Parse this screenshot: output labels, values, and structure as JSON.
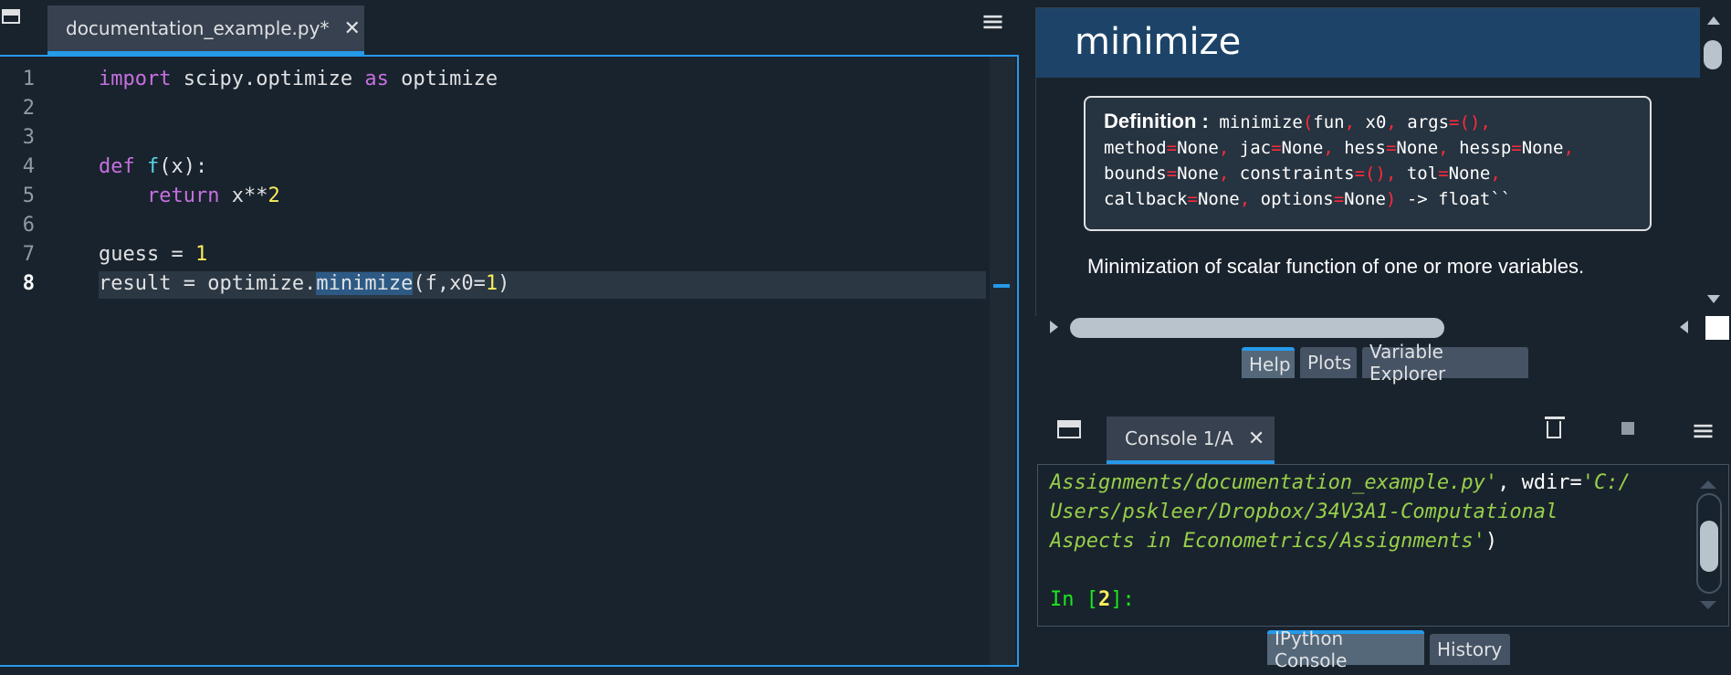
{
  "editor": {
    "tab_label": "documentation_example.py*",
    "tab_close": "✕",
    "menu_icon": "≡",
    "line_numbers": [
      "1",
      "2",
      "3",
      "4",
      "5",
      "6",
      "7",
      "8"
    ],
    "lines": {
      "l1_kw": "import",
      "l1_mod": " scipy.optimize ",
      "l1_as": "as",
      "l1_alias": " optimize",
      "l4_def": "def",
      "l4_name": "f",
      "l4_rest": "(x):",
      "l5_ret": "    return",
      "l5_rest": " x**",
      "l5_num": "2",
      "l7_lhs": "guess = ",
      "l7_num": "1",
      "l8_lhs": "result = optimize.",
      "l8_sel": "minimize",
      "l8_args": "(f,x0=",
      "l8_num": "1",
      "l8_close": ")"
    }
  },
  "help": {
    "title": "minimize",
    "definition_label": "Definition :",
    "definition_sig": {
      "name": " minimize",
      "open": "(",
      "p1": "fun",
      "p2": " x0",
      "p3": " args",
      "p3v": "()",
      "p4": "method",
      "p4v": "None",
      "p5": " jac",
      "p5v": "None",
      "p6": " hess",
      "p6v": "None",
      "p7": " hessp",
      "p7v": "None",
      "p8": "bounds",
      "p8v": "None",
      "p9": " constraints",
      "p9v": "()",
      "p10": " tol",
      "p10v": "None",
      "p11": "callback",
      "p11v": "None",
      "p12": " options",
      "p12v": "None",
      "close": ")",
      "ret": " -> float``"
    },
    "description": "Minimization of scalar function of one or more variables.",
    "tabs": [
      "Help",
      "Plots",
      "Variable Explorer"
    ]
  },
  "console": {
    "tab_label": "Console 1/A",
    "tab_close": "✕",
    "lines": {
      "c1a": "Assignments/documentation_example.py'",
      "c1b": ", wdir=",
      "c1c": "'C:/",
      "c2": "Users/pskleer/Dropbox/34V3A1-Computational",
      "c3a": "Aspects in Econometrics/Assignments'",
      "c3b": ")",
      "prompt_in": "In [",
      "prompt_num": "2",
      "prompt_end": "]:"
    },
    "tabs": [
      "IPython Console",
      "History"
    ]
  },
  "colors": {
    "accent": "#259ae9",
    "background": "#19232d",
    "keyword": "#c670e0",
    "function": "#57d6e4",
    "number": "#faed5c",
    "string": "#97cf4a",
    "prompt": "#1ce81c"
  },
  "icons": [
    "undock-icon",
    "close-icon",
    "hamburger-menu-icon",
    "trash-icon",
    "stop-icon",
    "scroll-arrow-icon"
  ]
}
